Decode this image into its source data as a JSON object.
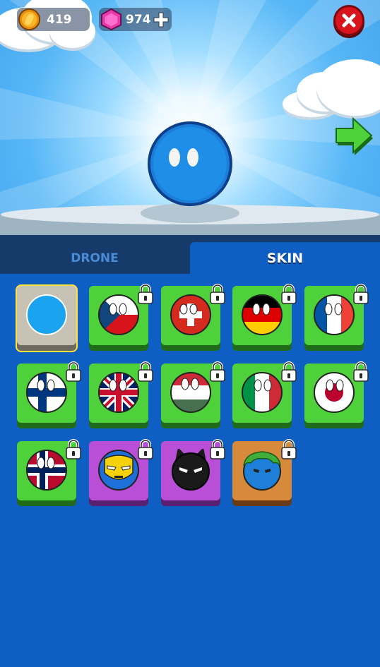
{
  "hud": {
    "coins": "419",
    "gems": "974",
    "coin_icon": "gold-coin-icon",
    "gem_icon": "pink-hexagon-gem-icon",
    "add_icon": "plus-icon"
  },
  "header": {
    "close_icon": "close-x-icon",
    "next_icon": "green-arrow-right-icon"
  },
  "tabs": [
    {
      "label": "DRONE",
      "active": false
    },
    {
      "label": "SKIN",
      "active": true
    }
  ],
  "skins": [
    {
      "name": "default-blue",
      "color": "#1aa3ee",
      "locked": false,
      "selected": true,
      "card": "gray"
    },
    {
      "name": "czech",
      "locked": true,
      "card": "green"
    },
    {
      "name": "switzerland",
      "locked": true,
      "card": "green"
    },
    {
      "name": "germany",
      "locked": true,
      "card": "green"
    },
    {
      "name": "france",
      "locked": true,
      "card": "green"
    },
    {
      "name": "finland",
      "locked": true,
      "card": "green"
    },
    {
      "name": "united-kingdom",
      "locked": true,
      "card": "green"
    },
    {
      "name": "hungary",
      "locked": true,
      "card": "green"
    },
    {
      "name": "italy",
      "locked": true,
      "card": "green"
    },
    {
      "name": "japan",
      "locked": true,
      "card": "green"
    },
    {
      "name": "norway",
      "locked": true,
      "card": "green"
    },
    {
      "name": "iron-hero",
      "locked": true,
      "card": "purple"
    },
    {
      "name": "bat-hero",
      "locked": true,
      "card": "purple"
    },
    {
      "name": "green-hat",
      "locked": true,
      "card": "orange"
    }
  ],
  "colors": {
    "panel_blue": "#0f5ec4",
    "tab_dark": "#163a6a",
    "card_green": "#4fd13c",
    "card_purple": "#b84fd6",
    "card_orange": "#d88a3c",
    "selected_outline": "#ffe23a",
    "close_red": "#d8141c"
  }
}
